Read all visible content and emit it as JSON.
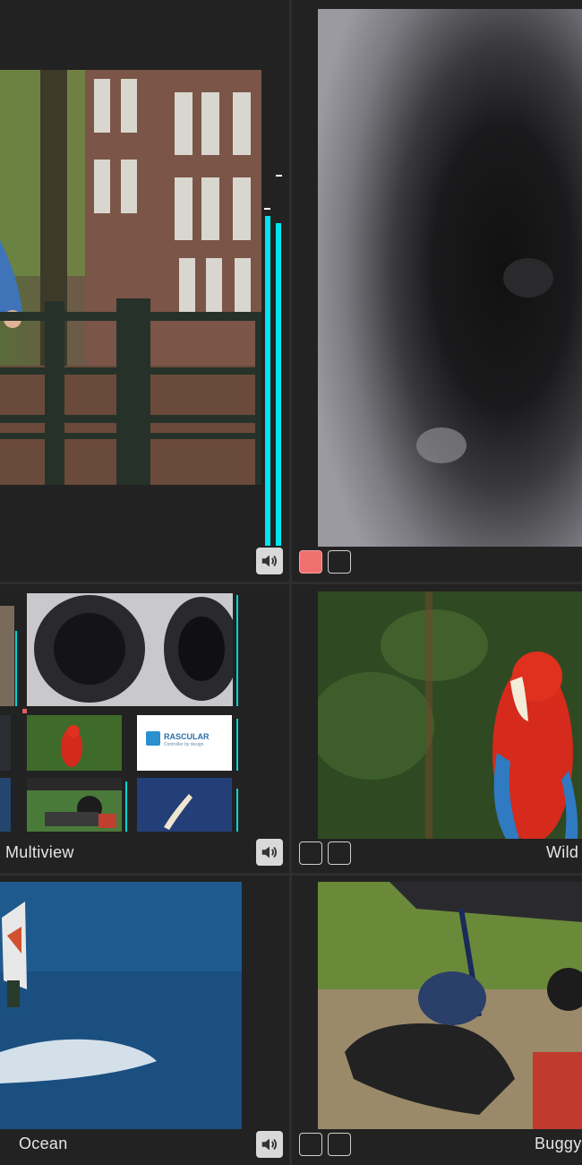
{
  "tiles": {
    "amsterdam": {
      "label": ""
    },
    "speaker": {
      "label": ""
    },
    "multiview": {
      "label": "Multiview"
    },
    "wild": {
      "label": "Wild"
    },
    "ocean": {
      "label": "Ocean"
    },
    "buggy": {
      "label": "Buggy"
    }
  },
  "multiview_thumb": {
    "logo_text": "RASCULAR",
    "logo_subtext": "Controller by design"
  },
  "meters": {
    "amsterdam_left_level": 0.88,
    "amsterdam_right_level": 0.86,
    "multiview_level": 0.82
  },
  "colors": {
    "meter": "#00e5ef",
    "toggle_active": "#f07070",
    "background": "#1e1e1e"
  },
  "icons": {
    "speaker": "speaker-icon"
  }
}
